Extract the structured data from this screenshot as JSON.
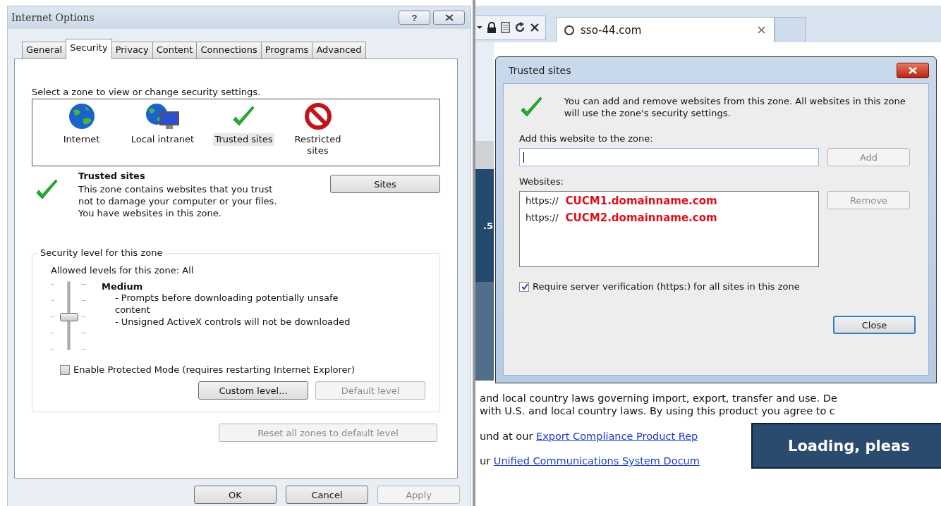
{
  "internet_options": {
    "title": "Internet Options",
    "help_glyph": "?",
    "tabs": [
      {
        "label": "General",
        "selected": false
      },
      {
        "label": "Security",
        "selected": true
      },
      {
        "label": "Privacy",
        "selected": false
      },
      {
        "label": "Content",
        "selected": false
      },
      {
        "label": "Connections",
        "selected": false
      },
      {
        "label": "Programs",
        "selected": false
      },
      {
        "label": "Advanced",
        "selected": false
      }
    ],
    "zone_prompt": "Select a zone to view or change security settings.",
    "zones": [
      {
        "label": "Internet",
        "kind": "internet",
        "selected": false
      },
      {
        "label": "Local intranet",
        "kind": "intranet",
        "selected": false
      },
      {
        "label": "Trusted sites",
        "kind": "trusted",
        "selected": true
      },
      {
        "label": "Restricted sites",
        "kind": "restricted",
        "selected": false
      }
    ],
    "zone_info": {
      "title": "Trusted sites",
      "description": "This zone contains websites that you trust not to damage your computer or your files.",
      "note": "You have websites in this zone."
    },
    "sites_button": "Sites",
    "security_level": {
      "legend": "Security level for this zone",
      "allowed": "Allowed levels for this zone: All",
      "level": 0.5,
      "name": "Medium",
      "bullets": [
        "- Prompts before downloading potentially unsafe content",
        "- Unsigned ActiveX controls will not be downloaded"
      ],
      "protected_mode": {
        "label": "Enable Protected Mode (requires restarting Internet Explorer)",
        "checked": false
      },
      "buttons": [
        {
          "label": "Custom level...",
          "disabled": false
        },
        {
          "label": "Default level",
          "disabled": true
        }
      ]
    },
    "reset_button": {
      "label": "Reset all zones to default level",
      "disabled": true
    },
    "footer_buttons": [
      {
        "label": "OK",
        "disabled": false
      },
      {
        "label": "Cancel",
        "disabled": false
      },
      {
        "label": "Apply",
        "disabled": true
      }
    ]
  },
  "browser": {
    "tab": {
      "title": "sso-44.com"
    },
    "banner_text": ".5",
    "page_lines": [
      {
        "text": "and local country laws governing import, export, transfer and use. De"
      },
      {
        "text": "with U.S. and local country laws. By using this product you agree to c"
      },
      {
        "text": "und at our ",
        "link": "Export Compliance Product Rep"
      },
      {
        "text": "ur ",
        "link": "Unified Communications System Docum"
      }
    ],
    "loading": "Loading, pleas"
  },
  "trusted_sites": {
    "title": "Trusted sites",
    "message": "You can add and remove websites from this zone. All websites in this zone will use the zone's security settings.",
    "add_label": "Add this website to the zone:",
    "add_button": {
      "label": "Add",
      "disabled": true
    },
    "websites_label": "Websites:",
    "websites": [
      {
        "scheme": "https://",
        "host": "CUCM1.domainname.com"
      },
      {
        "scheme": "https://",
        "host": "CUCM2.domainname.com"
      }
    ],
    "remove_button": {
      "label": "Remove",
      "disabled": true
    },
    "require_verification": {
      "label": "Require server verification (https:) for all sites in this zone",
      "checked": true
    },
    "close_button": {
      "label": "Close",
      "disabled": false
    }
  }
}
